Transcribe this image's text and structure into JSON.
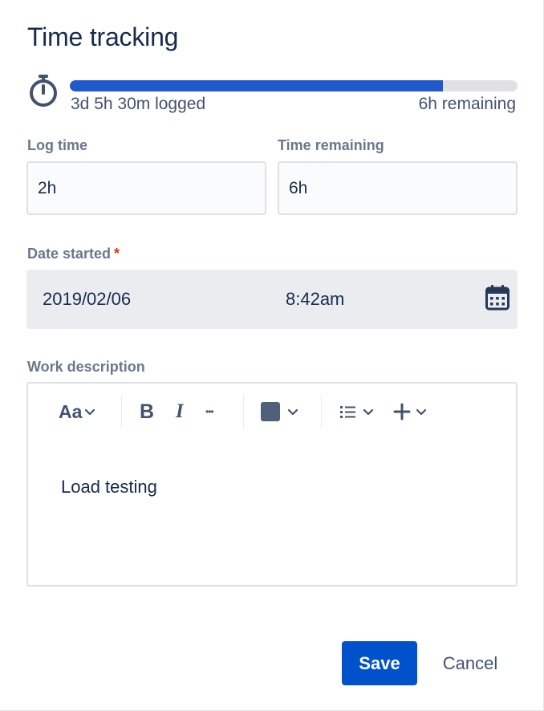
{
  "dialog": {
    "title": "Time tracking"
  },
  "progress": {
    "logged_label": "3d 5h 30m logged",
    "remaining_label": "6h remaining",
    "logged_fraction": 0.833,
    "bar_color": "#1f59cc",
    "track_color": "#dfe1e6"
  },
  "log_time": {
    "label": "Log time",
    "value": "2h"
  },
  "time_remaining": {
    "label": "Time remaining",
    "value": "6h"
  },
  "date_started": {
    "label": "Date started",
    "required_marker": "*",
    "date": "2019/02/06",
    "time": "8:42am"
  },
  "work_description": {
    "label": "Work description",
    "toolbar": {
      "text_style": "Aa",
      "bold": "B",
      "italic": "I",
      "more": "•••",
      "text_color": "#505f79"
    },
    "content": "Load testing"
  },
  "actions": {
    "save_label": "Save",
    "cancel_label": "Cancel",
    "primary_color": "#0052cc"
  }
}
